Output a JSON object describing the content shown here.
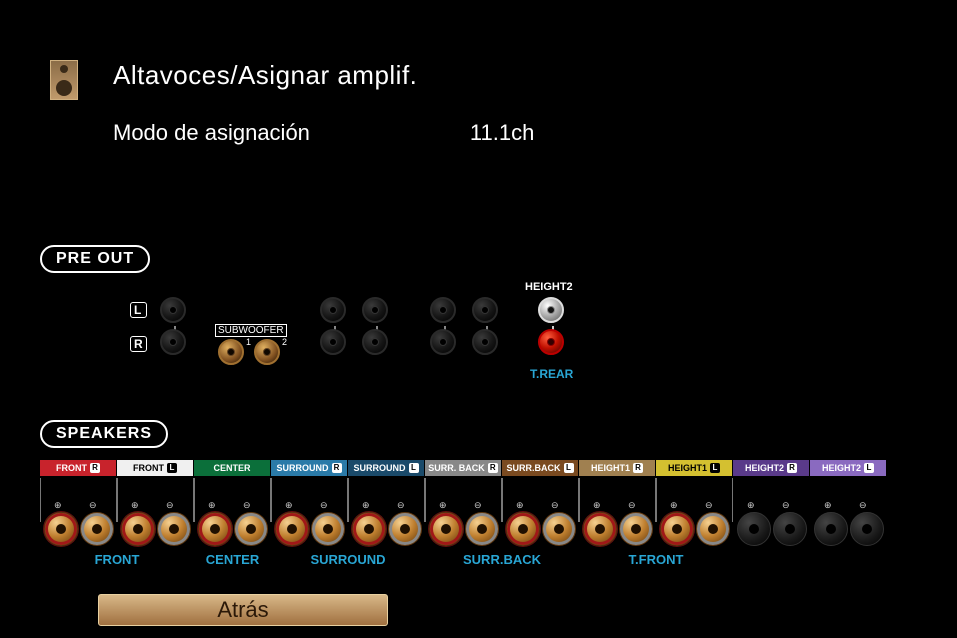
{
  "header": {
    "title": "Altavoces/Asignar amplif.",
    "mode_label": "Modo de asignación",
    "mode_value": "11.1ch"
  },
  "sections": {
    "preout": "PRE OUT",
    "speakers": "SPEAKERS"
  },
  "preout": {
    "l": "L",
    "r": "R",
    "subwoofer": "SUBWOOFER",
    "sub1": "1",
    "sub2": "2",
    "height2": "HEIGHT2",
    "trear": "T.REAR"
  },
  "speaker_channels": [
    {
      "label": "FRONT",
      "side": "R",
      "color": "c-red"
    },
    {
      "label": "FRONT",
      "side": "L",
      "color": "c-white"
    },
    {
      "label": "CENTER",
      "side": "",
      "color": "c-green"
    },
    {
      "label": "SURROUND",
      "side": "R",
      "color": "c-blue"
    },
    {
      "label": "SURROUND",
      "side": "L",
      "color": "c-dblue"
    },
    {
      "label": "SURR. BACK",
      "side": "R",
      "color": "c-gray"
    },
    {
      "label": "SURR.BACK",
      "side": "L",
      "color": "c-brown"
    },
    {
      "label": "HEIGHT1",
      "side": "R",
      "color": "c-tan"
    },
    {
      "label": "HEIGHT1",
      "side": "L",
      "color": "c-yellow"
    },
    {
      "label": "HEIGHT2",
      "side": "R",
      "color": "c-purple"
    },
    {
      "label": "HEIGHT2",
      "side": "L",
      "color": "c-lpurple"
    }
  ],
  "bottom_labels": [
    "FRONT",
    "CENTER",
    "SURROUND",
    "SURR.BACK",
    "T.FRONT"
  ],
  "polarity": {
    "plus": "⊕",
    "minus": "⊖"
  },
  "buttons": {
    "back": "Atrás"
  }
}
